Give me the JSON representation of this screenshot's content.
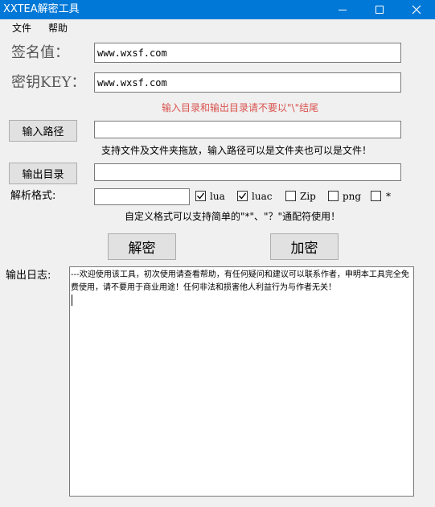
{
  "window": {
    "title": "XXTEA解密工具"
  },
  "menu": {
    "items": [
      "文件",
      "帮助"
    ]
  },
  "sign": {
    "label": "签名值：",
    "value": "www.wxsf.com"
  },
  "key": {
    "label": "密钥KEY：",
    "value": "www.wxsf.com"
  },
  "warning": "输入目录和输出目录请不要以\"\\\"结尾",
  "input_path": {
    "button": "输入路径",
    "value": "",
    "hint": "支持文件及文件夹拖放，输入路径可以是文件夹也可以是文件！"
  },
  "output_dir": {
    "button": "输出目录",
    "value": ""
  },
  "format": {
    "label": "解析格式:",
    "value": "",
    "options": [
      {
        "label": "lua",
        "checked": true
      },
      {
        "label": "luac",
        "checked": true
      },
      {
        "label": "Zip",
        "checked": false
      },
      {
        "label": "png",
        "checked": false
      },
      {
        "label": "*",
        "checked": false
      }
    ],
    "hint": "自定义格式可以支持简单的\"*\"、\"？\"通配符使用！"
  },
  "actions": {
    "decrypt": "解密",
    "encrypt": "加密"
  },
  "log": {
    "label": "输出日志:",
    "text": "---欢迎使用该工具，初次使用请查看帮助，有任何疑问和建议可以联系作者，申明本工具完全免费使用，请不要用于商业用途！任何非法和损害他人利益行为与作者无关！"
  },
  "colors": {
    "titlebar": "#0078d7",
    "warning": "#d9534f"
  }
}
